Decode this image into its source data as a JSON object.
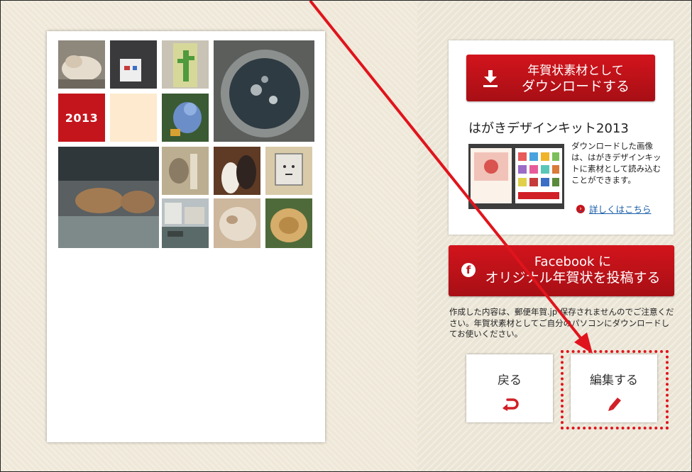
{
  "card": {
    "year_label": "2013"
  },
  "panel": {
    "download_button": {
      "line1": "年賀状素材として",
      "line2": "ダウンロードする"
    },
    "kit_title": "はがきデザインキット2013",
    "kit_desc": "ダウンロードした画像は、はがきデザインキットに素材として読み込むことができます。",
    "details_link": "詳しくはこちら"
  },
  "facebook_button": {
    "line1": "Facebook に",
    "line2": "オリジナル年賀状を投稿する"
  },
  "note": "作成した内容は、郵便年賀.jp 保存されませんのでご注意ください。年賀状素材としてご自分のパソコンにダウンロードしてお使いください。",
  "buttons": {
    "back_label": "戻る",
    "edit_label": "編集する"
  },
  "colors": {
    "brand_red": "#c4151c",
    "annotation_red": "#e0141c",
    "background": "#efe8d8"
  },
  "icons": [
    "download-icon",
    "facebook-icon",
    "return-arrow-icon",
    "pencil-icon"
  ]
}
